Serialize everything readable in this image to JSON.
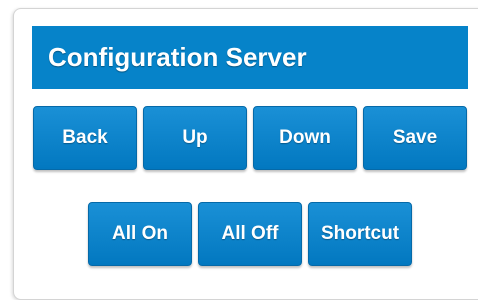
{
  "header": {
    "title": "Configuration Server"
  },
  "nav_buttons": {
    "back": "Back",
    "up": "Up",
    "down": "Down",
    "save": "Save"
  },
  "action_buttons": {
    "all_on": "All On",
    "all_off": "All Off",
    "shortcut": "Shortcut"
  },
  "colors": {
    "accent": "#0683c9",
    "button": "#0a84cb",
    "text": "#ffffff"
  }
}
